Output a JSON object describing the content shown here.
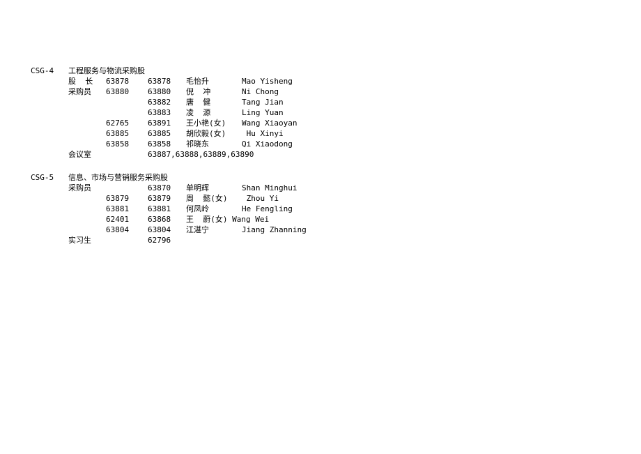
{
  "sections": [
    {
      "code": "CSG-4",
      "dept": "工程服务与物流采购股",
      "rows": [
        {
          "role": "股  长",
          "ext1": "63878",
          "ext2": "63878",
          "name_cn": "毛怡升",
          "name_en": "Mao Yisheng"
        },
        {
          "role": "采购员",
          "ext1": "63880",
          "ext2": "63880",
          "name_cn": "倪  冲",
          "name_en": "Ni Chong"
        },
        {
          "role": "",
          "ext1": "",
          "ext2": "63882",
          "name_cn": "唐  健",
          "name_en": "Tang Jian"
        },
        {
          "role": "",
          "ext1": "",
          "ext2": "63883",
          "name_cn": "凌  源",
          "name_en": "Ling Yuan"
        },
        {
          "role": "",
          "ext1": "62765",
          "ext2": "63891",
          "name_cn": "王小艳(女)",
          "name_en": "Wang Xiaoyan"
        },
        {
          "role": "",
          "ext1": "63885",
          "ext2": "63885",
          "name_cn": "胡欣毅(女)",
          "name_en": " Hu Xinyi"
        },
        {
          "role": "",
          "ext1": "63858",
          "ext2": "63858",
          "name_cn": "祁晓东",
          "name_en": "Qi Xiaodong"
        },
        {
          "role": "会议室",
          "ext1": "",
          "ext2": "63887,63888,63889,63890",
          "name_cn": "",
          "name_en": ""
        }
      ]
    },
    {
      "code": "CSG-5",
      "dept": "信息、市场与营销服务采购股",
      "rows": [
        {
          "role": "采购员",
          "ext1": "",
          "ext2": "63870",
          "name_cn": "单明辉",
          "name_en": "Shan Minghui"
        },
        {
          "role": "",
          "ext1": "63879",
          "ext2": "63879",
          "name_cn": "周  懿(女)",
          "name_en": " Zhou Yi"
        },
        {
          "role": "",
          "ext1": "63881",
          "ext2": "63881",
          "name_cn": "何凤岭",
          "name_en": "He Fengling"
        },
        {
          "role": "",
          "ext1": "62401",
          "ext2": "63868",
          "name_cn": "王  蔚(女)",
          "name_en": "Wang Wei",
          "name_en_pad": true
        },
        {
          "role": "",
          "ext1": "63804",
          "ext2": "63804",
          "name_cn": "江湛宁",
          "name_en": "Jiang Zhanning"
        },
        {
          "role": "实习生",
          "ext1": "",
          "ext2": "62796",
          "name_cn": "",
          "name_en": ""
        }
      ]
    }
  ]
}
